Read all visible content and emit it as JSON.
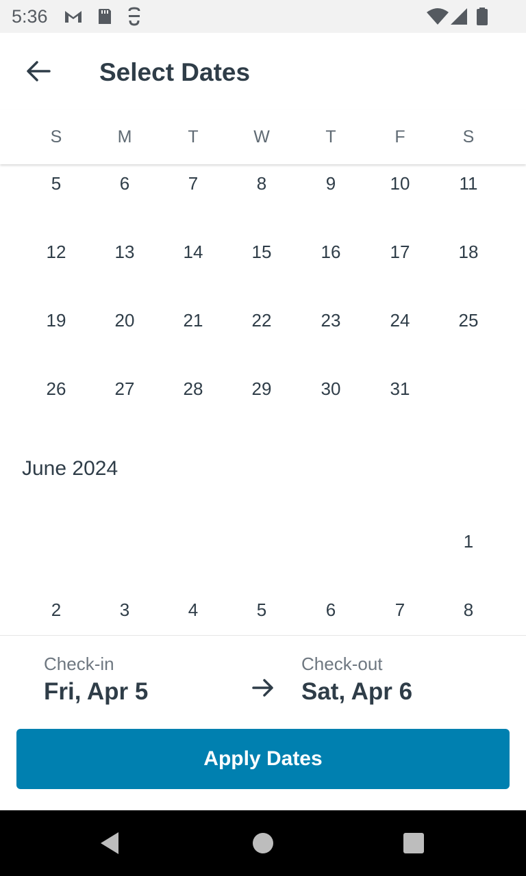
{
  "status_bar": {
    "time": "5:36",
    "left_icons": [
      "gmail-icon",
      "sd-card-icon",
      "vpn-key-icon"
    ],
    "right_icons": [
      "wifi-icon",
      "signal-icon",
      "battery-icon"
    ]
  },
  "header": {
    "back_icon": "back-arrow-icon",
    "title": "Select Dates"
  },
  "weekdays": [
    "S",
    "M",
    "T",
    "W",
    "T",
    "F",
    "S"
  ],
  "calendar": {
    "may_rows": [
      [
        "5",
        "6",
        "7",
        "8",
        "9",
        "10",
        "11"
      ],
      [
        "12",
        "13",
        "14",
        "15",
        "16",
        "17",
        "18"
      ],
      [
        "19",
        "20",
        "21",
        "22",
        "23",
        "24",
        "25"
      ],
      [
        "26",
        "27",
        "28",
        "29",
        "30",
        "31",
        ""
      ]
    ],
    "june_label": "June 2024",
    "june_rows": [
      [
        "",
        "",
        "",
        "",
        "",
        "",
        "1"
      ],
      [
        "2",
        "3",
        "4",
        "5",
        "6",
        "7",
        "8"
      ]
    ]
  },
  "summary": {
    "checkin_label": "Check-in",
    "checkin_value": "Fri, Apr 5",
    "arrow_icon": "right-arrow-icon",
    "checkout_label": "Check-out",
    "checkout_value": "Sat, Apr 6",
    "apply_label": "Apply Dates",
    "accent_color": "#0080b0"
  },
  "nav_bar": [
    "back-triangle-icon",
    "home-circle-icon",
    "recents-square-icon"
  ]
}
